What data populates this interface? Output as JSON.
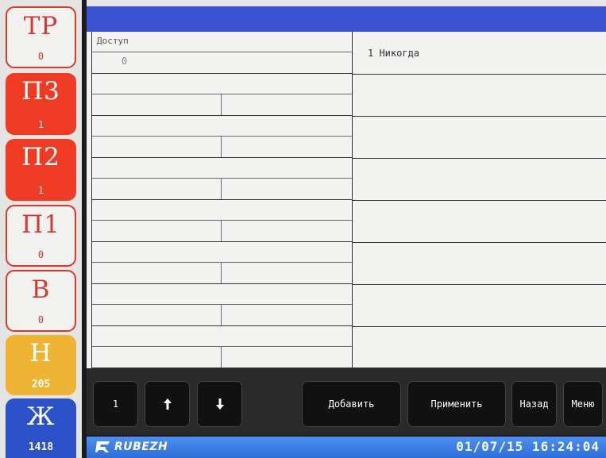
{
  "status_tiles": [
    {
      "code": "ТР",
      "count": "0"
    },
    {
      "code": "П3",
      "count": "1"
    },
    {
      "code": "П2",
      "count": "1"
    },
    {
      "code": "П1",
      "count": "0"
    },
    {
      "code": "В",
      "count": "0"
    },
    {
      "code": "Н",
      "count": "205"
    },
    {
      "code": "Ж",
      "count": "1418"
    }
  ],
  "colors": {
    "tile_outline_red": "#d33a30",
    "tile_red": "#ef3a24",
    "tile_yellow": "#f0b434",
    "tile_blue": "#2b52c9",
    "top_bar": "#3b52d0",
    "status_bar": "#3a7fe6"
  },
  "form": {
    "access_label": "Доступ",
    "access_value": "0"
  },
  "list": {
    "items": [
      "1 Никогда"
    ]
  },
  "buttons": {
    "page": "1",
    "up_icon": "arrow-up",
    "down_icon": "arrow-down",
    "add": "Добавить",
    "apply": "Применить",
    "back": "Назад",
    "menu": "Меню"
  },
  "status_bar": {
    "logo_text": "RUBEZH",
    "datetime": "01/07/15 16:24:04"
  }
}
